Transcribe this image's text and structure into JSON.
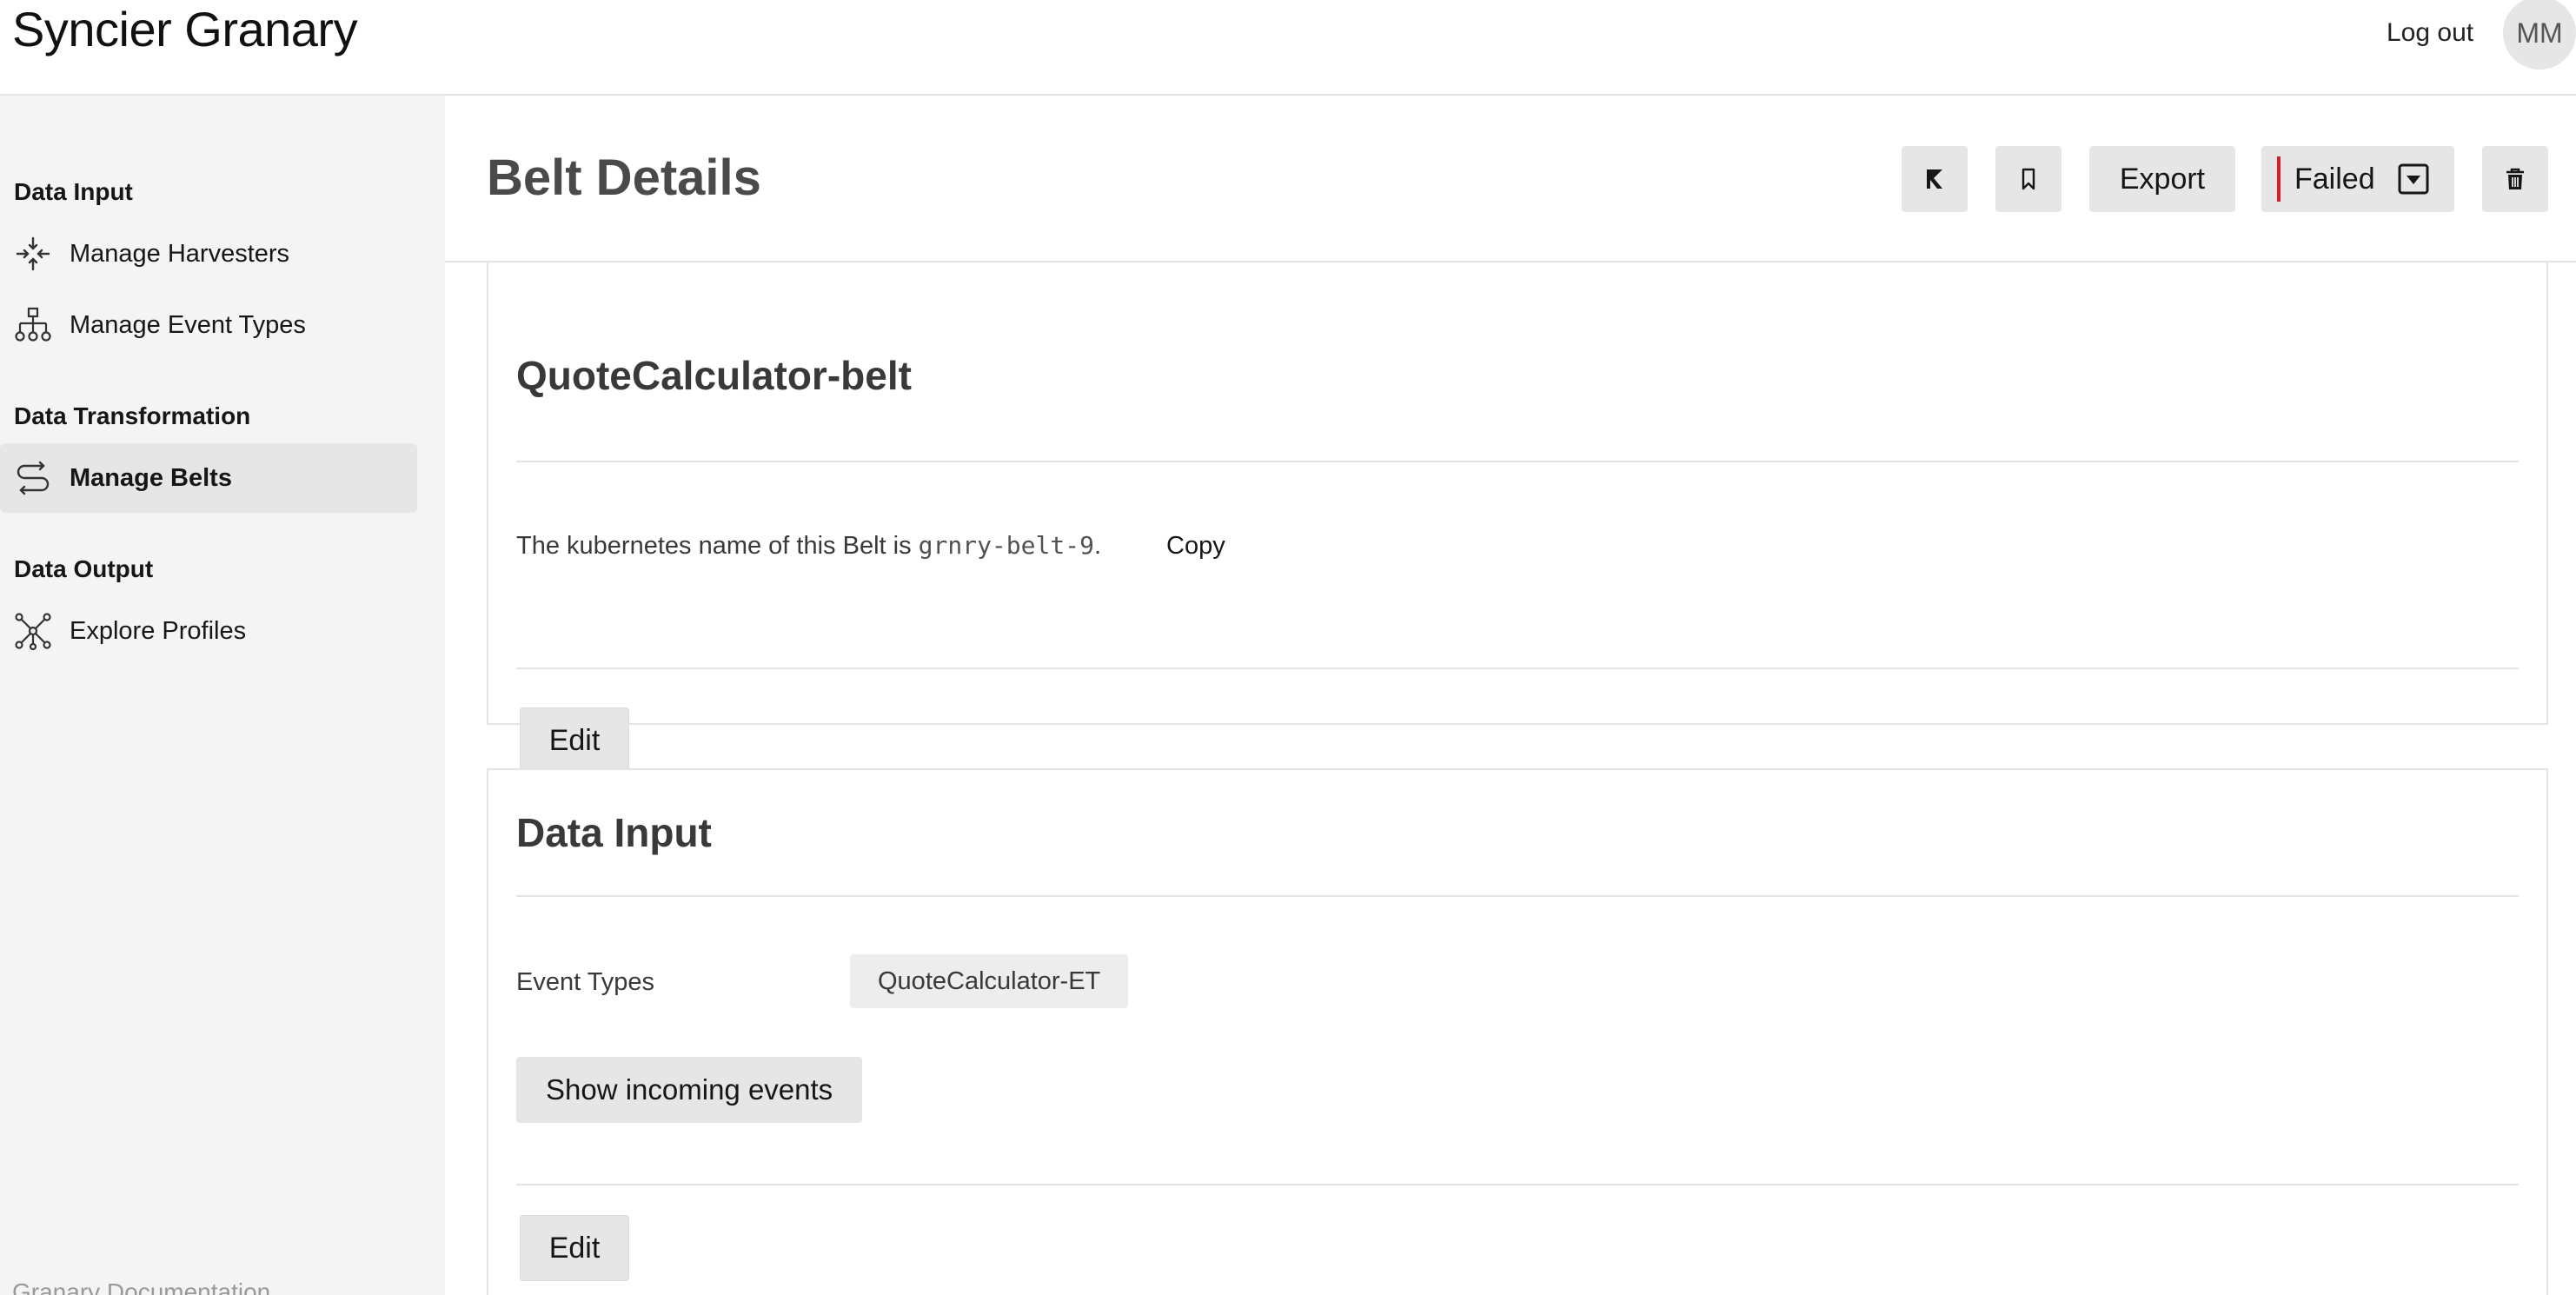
{
  "app": {
    "title": "Syncier Granary"
  },
  "header": {
    "logout_label": "Log out",
    "avatar_initials": "MM"
  },
  "sidebar": {
    "sections": [
      {
        "heading": "Data Input",
        "items": [
          {
            "label": "Manage Harvesters",
            "icon": "harvester-icon"
          },
          {
            "label": "Manage Event Types",
            "icon": "hierarchy-icon"
          }
        ]
      },
      {
        "heading": "Data Transformation",
        "items": [
          {
            "label": "Manage Belts",
            "icon": "belt-route-icon",
            "active": true
          }
        ]
      },
      {
        "heading": "Data Output",
        "items": [
          {
            "label": "Explore Profiles",
            "icon": "network-icon"
          }
        ]
      }
    ],
    "footer": "Granary Documentation"
  },
  "page": {
    "title": "Belt Details",
    "toolbar": {
      "kafka_icon": "kafka-icon",
      "bookmark_icon": "bookmark-icon",
      "export_label": "Export",
      "status_label": "Failed",
      "status_color": "#da1e28",
      "delete_icon": "trash-icon"
    }
  },
  "belt_card": {
    "title": "QuoteCalculator-belt",
    "k8s_prefix": "The kubernetes name of this Belt is ",
    "k8s_name": "grnry-belt-9",
    "k8s_suffix": ".",
    "copy_label": "Copy",
    "edit_label": "Edit"
  },
  "data_input_card": {
    "title": "Data Input",
    "event_types_label": "Event Types",
    "event_type": "QuoteCalculator-ET",
    "show_events_label": "Show incoming events",
    "edit_label": "Edit"
  }
}
